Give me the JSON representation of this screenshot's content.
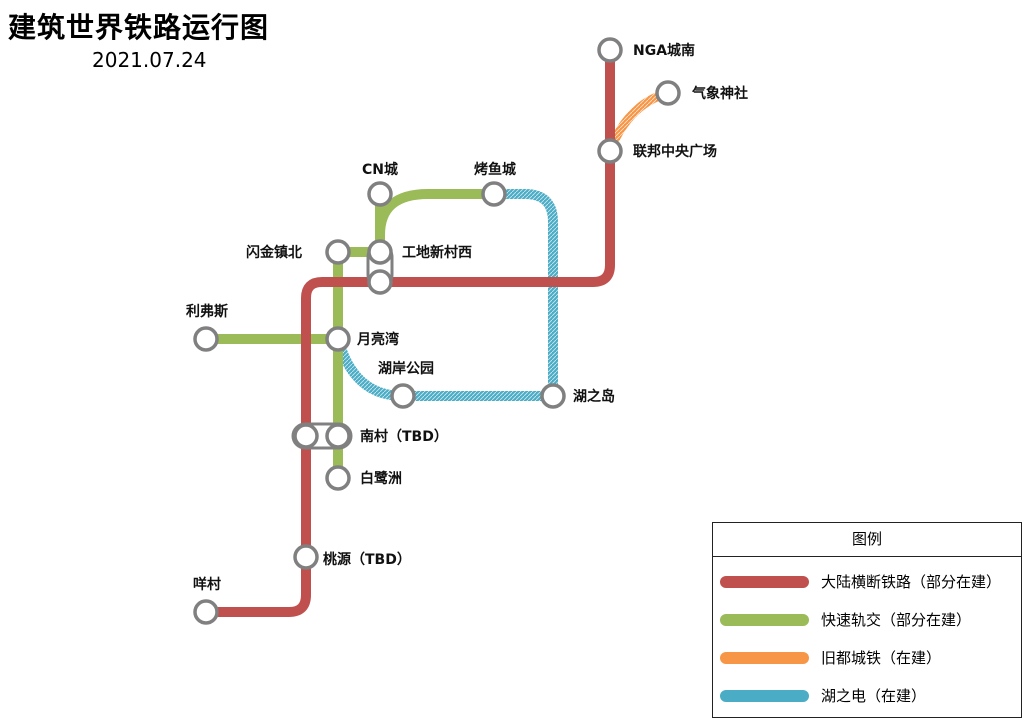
{
  "header": {
    "title": "建筑世界铁路运行图",
    "date": "2021.07.24"
  },
  "colors": {
    "red": "#C0504D",
    "green": "#9BBB59",
    "orange": "#F79646",
    "blue": "#4BACC6",
    "station_ring": "#808080"
  },
  "stations": {
    "nga": "NGA城南",
    "qixiang": "气象神社",
    "lianbang": "联邦中央广场",
    "cn": "CN城",
    "kaoyu": "烤鱼城",
    "shanjin": "闪金镇北",
    "gongdi": "工地新村西",
    "lifusi": "利弗斯",
    "yueliang": "月亮湾",
    "huan": "湖岸公园",
    "huzhidao": "湖之岛",
    "nancun": "南村（TBD）",
    "bailu": "白鹭洲",
    "taoyuan": "桃源（TBD）",
    "yangcun": "咩村"
  },
  "legend": {
    "title": "图例",
    "items": [
      {
        "label": "大陆横断铁路（部分在建）",
        "color": "#C0504D"
      },
      {
        "label": "快速轨交（部分在建）",
        "color": "#9BBB59"
      },
      {
        "label": "旧都城铁（在建）",
        "color": "#F79646"
      },
      {
        "label": "湖之电（在建）",
        "color": "#4BACC6"
      }
    ]
  }
}
